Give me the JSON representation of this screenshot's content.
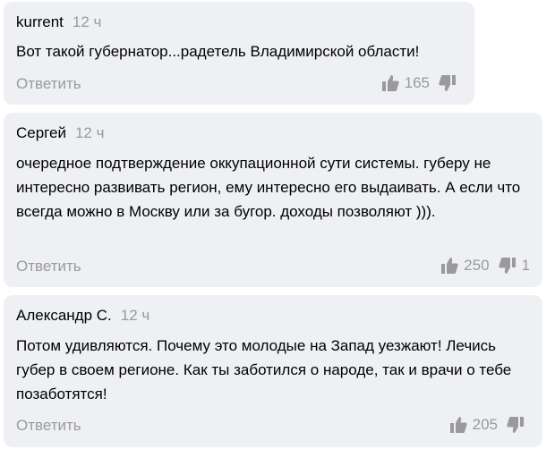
{
  "comments": [
    {
      "author": "kurrent",
      "time": "12 ч",
      "text": "Вот такой губернатор...радетель Владимирской области!",
      "reply_label": "Ответить",
      "likes": "165",
      "dislikes": ""
    },
    {
      "author": "Сергей",
      "time": "12 ч",
      "text": "очередное подтверждение оккупационной сути системы. губеру не интересно развивать регион, ему интересно его выдаивать. А если что всегда можно в Москву или за бугор. доходы позволяют ))).",
      "reply_label": "Ответить",
      "likes": "250",
      "dislikes": "1"
    },
    {
      "author": "Александр С.",
      "time": "12 ч",
      "text": "Потом удивляются. Почему это молодые на Запад уезжают! Лечись губер в своем регионе. Как ты заботился о народе, так и врачи о тебе позаботятся!",
      "reply_label": "Ответить",
      "likes": "205",
      "dislikes": ""
    }
  ],
  "icons": {
    "like": "thumbs-up-icon",
    "dislike": "thumbs-down-icon"
  },
  "colors": {
    "card_background": "#eef0f3",
    "muted_text": "#9a9a9a",
    "icon_color": "#9a9a9a"
  }
}
